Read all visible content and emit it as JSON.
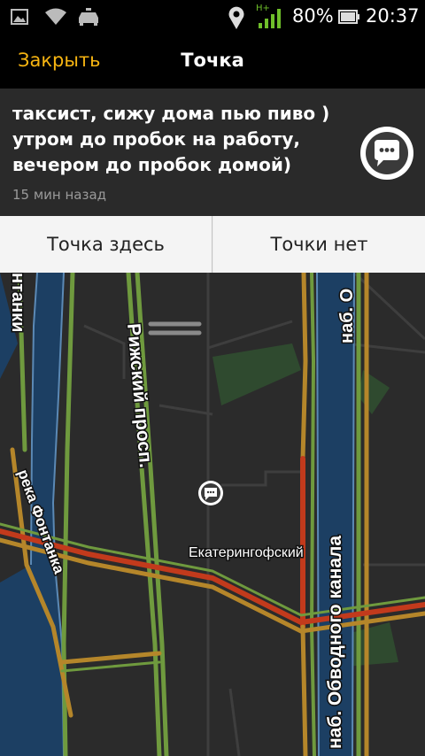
{
  "status_bar": {
    "icons": [
      "image-icon",
      "wifi-icon",
      "taxi-icon",
      "location-icon",
      "cell-signal-icon",
      "battery-icon"
    ],
    "network_type": "H+",
    "battery": "80%",
    "time": "20:37"
  },
  "nav": {
    "close_label": "Закрыть",
    "title": "Точка"
  },
  "message": {
    "text": "таксист, сижу дома пью пиво ) утром до пробок на работу, вечером до пробок домой)",
    "time_ago": "15 мин назад",
    "chat_icon": "chat-bubble-icon"
  },
  "actions": {
    "here_label": "Точка здесь",
    "absent_label": "Точки нет"
  },
  "map": {
    "labels": {
      "fontanka_top": "нтанки",
      "river_fontanka": "река Фонтанка",
      "rizhsky": "Рижский просп.",
      "obvodny_top": "наб. О",
      "ekateringofsky": "Екатерингофский",
      "obvodny_canal": "наб. Обводного канала"
    },
    "colors": {
      "background": "#2b2b2b",
      "water": "#1c3f63",
      "traffic_green": "#6f9a3e",
      "traffic_yellow": "#b5862a",
      "traffic_red": "#c23a1c",
      "park": "#2f4a2f"
    }
  }
}
